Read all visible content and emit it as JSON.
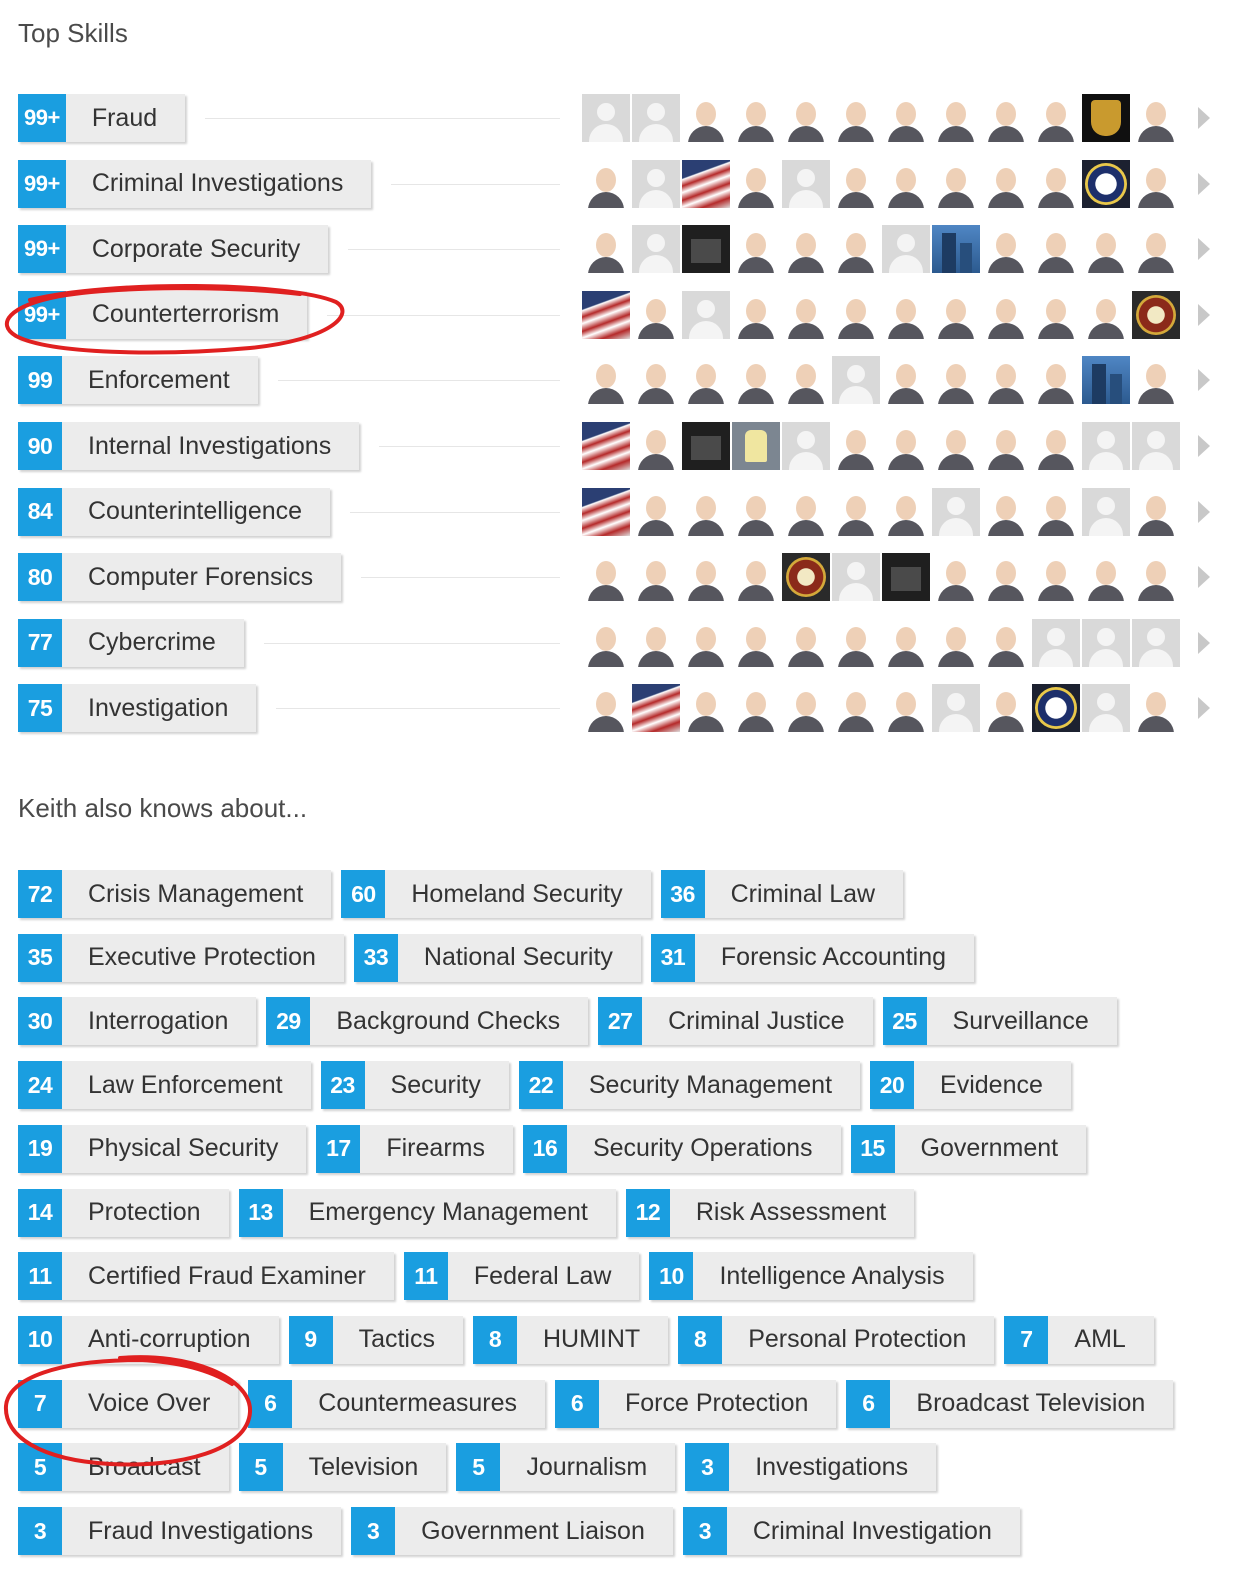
{
  "sections": {
    "top_skills_title": "Top Skills",
    "also_knows_title": "Keith also knows about..."
  },
  "colors": {
    "badge": "#1a9ee0",
    "label_bg": "#ececec",
    "annotation": "#e02020"
  },
  "top_skills": [
    {
      "count": "99+",
      "label": "Fraud",
      "avatars": [
        "blank",
        "blank",
        "photo",
        "photo",
        "photo",
        "photo",
        "photo",
        "photo",
        "photo",
        "photo",
        "gold",
        "photo"
      ]
    },
    {
      "count": "99+",
      "label": "Criminal Investigations",
      "avatars": [
        "photo",
        "blank",
        "flag",
        "photo",
        "blank",
        "photo",
        "photo",
        "photo",
        "photo",
        "photo",
        "seal",
        "photo"
      ]
    },
    {
      "count": "99+",
      "label": "Corporate Security",
      "avatars": [
        "photo",
        "blank",
        "dark",
        "photo",
        "photo",
        "photo",
        "blank",
        "building",
        "photo",
        "photo",
        "photo",
        "photo"
      ]
    },
    {
      "count": "99+",
      "label": "Counterterrorism",
      "avatars": [
        "flag",
        "photo",
        "blank",
        "photo",
        "photo",
        "photo",
        "photo",
        "photo",
        "photo",
        "photo",
        "photo",
        "badge-emblem"
      ]
    },
    {
      "count": "99",
      "label": "Enforcement",
      "avatars": [
        "photo",
        "photo",
        "photo",
        "photo",
        "photo",
        "blank",
        "photo",
        "photo",
        "photo",
        "photo",
        "building",
        "photo"
      ]
    },
    {
      "count": "90",
      "label": "Internal Investigations",
      "avatars": [
        "flag",
        "photo",
        "dark",
        "sculpt",
        "blank",
        "photo",
        "photo",
        "photo",
        "photo",
        "photo",
        "blank",
        "blank"
      ]
    },
    {
      "count": "84",
      "label": "Counterintelligence",
      "avatars": [
        "flag",
        "photo",
        "photo",
        "photo",
        "photo",
        "photo",
        "photo",
        "blank",
        "photo",
        "photo",
        "blank",
        "photo"
      ]
    },
    {
      "count": "80",
      "label": "Computer Forensics",
      "avatars": [
        "photo",
        "photo",
        "photo",
        "photo",
        "badge-emblem",
        "blank",
        "dark",
        "photo",
        "photo",
        "photo",
        "photo",
        "photo"
      ]
    },
    {
      "count": "77",
      "label": "Cybercrime",
      "avatars": [
        "photo",
        "photo",
        "photo",
        "photo",
        "photo",
        "photo",
        "photo",
        "photo",
        "photo",
        "blank",
        "blank",
        "blank"
      ]
    },
    {
      "count": "75",
      "label": "Investigation",
      "avatars": [
        "photo",
        "flag",
        "photo",
        "photo",
        "photo",
        "photo",
        "photo",
        "blank",
        "photo",
        "seal",
        "blank",
        "photo"
      ]
    }
  ],
  "also_knows": [
    [
      {
        "count": "72",
        "label": "Crisis Management"
      },
      {
        "count": "60",
        "label": "Homeland Security"
      },
      {
        "count": "36",
        "label": "Criminal Law"
      }
    ],
    [
      {
        "count": "35",
        "label": "Executive Protection"
      },
      {
        "count": "33",
        "label": "National Security"
      },
      {
        "count": "31",
        "label": "Forensic Accounting"
      }
    ],
    [
      {
        "count": "30",
        "label": "Interrogation"
      },
      {
        "count": "29",
        "label": "Background Checks"
      },
      {
        "count": "27",
        "label": "Criminal Justice"
      },
      {
        "count": "25",
        "label": "Surveillance"
      }
    ],
    [
      {
        "count": "24",
        "label": "Law Enforcement"
      },
      {
        "count": "23",
        "label": "Security"
      },
      {
        "count": "22",
        "label": "Security Management"
      },
      {
        "count": "20",
        "label": "Evidence"
      }
    ],
    [
      {
        "count": "19",
        "label": "Physical Security"
      },
      {
        "count": "17",
        "label": "Firearms"
      },
      {
        "count": "16",
        "label": "Security Operations"
      },
      {
        "count": "15",
        "label": "Government"
      }
    ],
    [
      {
        "count": "14",
        "label": "Protection"
      },
      {
        "count": "13",
        "label": "Emergency Management"
      },
      {
        "count": "12",
        "label": "Risk Assessment"
      }
    ],
    [
      {
        "count": "11",
        "label": "Certified Fraud Examiner"
      },
      {
        "count": "11",
        "label": "Federal Law"
      },
      {
        "count": "10",
        "label": "Intelligence Analysis"
      }
    ],
    [
      {
        "count": "10",
        "label": "Anti-corruption"
      },
      {
        "count": "9",
        "label": "Tactics"
      },
      {
        "count": "8",
        "label": "HUMINT"
      },
      {
        "count": "8",
        "label": "Personal Protection"
      },
      {
        "count": "7",
        "label": "AML"
      }
    ],
    [
      {
        "count": "7",
        "label": "Voice Over"
      },
      {
        "count": "6",
        "label": "Countermeasures"
      },
      {
        "count": "6",
        "label": "Force Protection"
      },
      {
        "count": "6",
        "label": "Broadcast Television"
      }
    ],
    [
      {
        "count": "5",
        "label": "Broadcast"
      },
      {
        "count": "5",
        "label": "Television"
      },
      {
        "count": "5",
        "label": "Journalism"
      },
      {
        "count": "3",
        "label": "Investigations"
      }
    ],
    [
      {
        "count": "3",
        "label": "Fraud Investigations"
      },
      {
        "count": "3",
        "label": "Government Liaison"
      },
      {
        "count": "3",
        "label": "Criminal Investigation"
      }
    ]
  ]
}
